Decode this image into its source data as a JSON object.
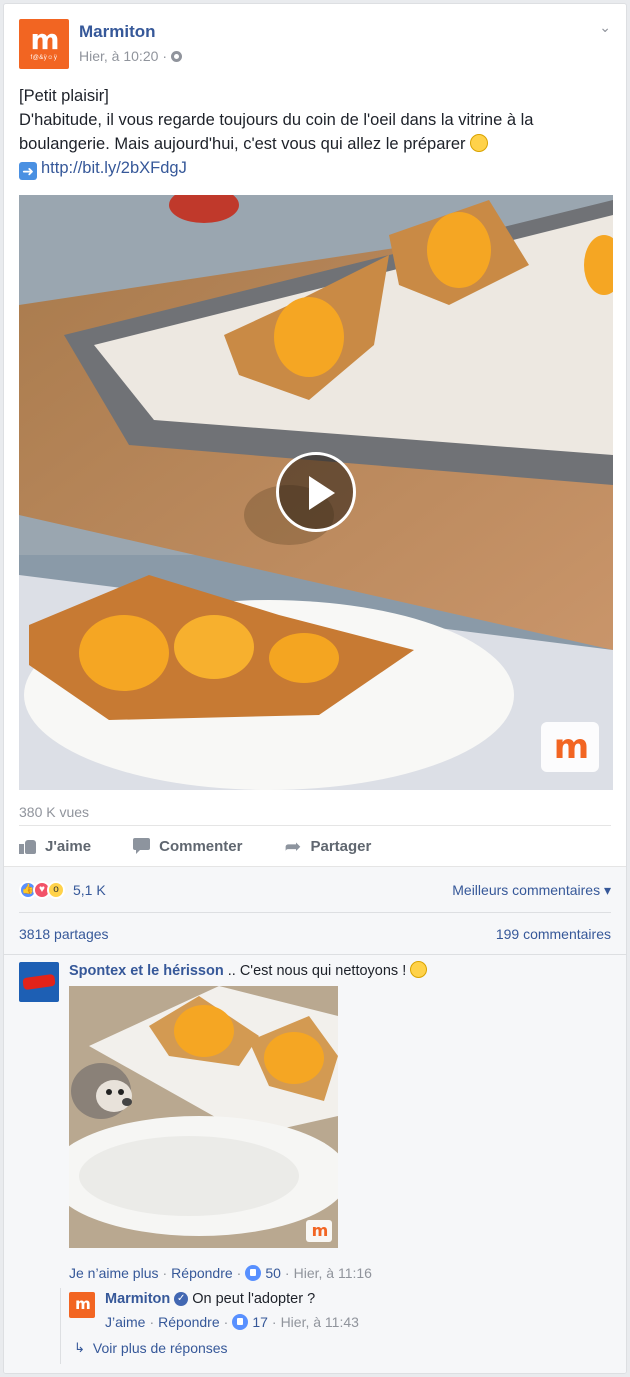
{
  "post": {
    "page_name": "Marmiton",
    "logo_letter": "m",
    "logo_tagline": "f@&ÿ☺ÿ",
    "time": "Hier, à 10:20",
    "separator": "·",
    "text_lines": [
      "[Petit plaisir]",
      "D'habitude, il vous regarde toujours du coin de l'oeil dans la vitrine à la",
      "boulangerie. Mais aujourd'hui, c'est vous qui allez le préparer "
    ],
    "link": "http://bit.ly/2bXFdgJ",
    "views": "380 K vues"
  },
  "actions": {
    "like": "J'aime",
    "comment": "Commenter",
    "share": "Partager"
  },
  "reactions": {
    "count": "5,1 K",
    "top_comments": "Meilleurs commentaires",
    "shares": "3818 partages",
    "comments": "199 commentaires"
  },
  "comment": {
    "author": "Spontex et le hérisson",
    "text": " .. C'est nous qui nettoyons ! ",
    "unlike": "Je n’aime plus",
    "reply": "Répondre",
    "likes": "50",
    "time": "Hier, à 11:16"
  },
  "reply": {
    "author": "Marmiton",
    "text": "On peut l'adopter ?",
    "like": "J’aime",
    "reply": "Répondre",
    "likes": "17",
    "time": "Hier, à 11:43"
  },
  "more_replies": "Voir plus de réponses",
  "colors": {
    "brand_orange": "#f26522",
    "link_blue": "#365899",
    "meta_grey": "#90949c"
  }
}
